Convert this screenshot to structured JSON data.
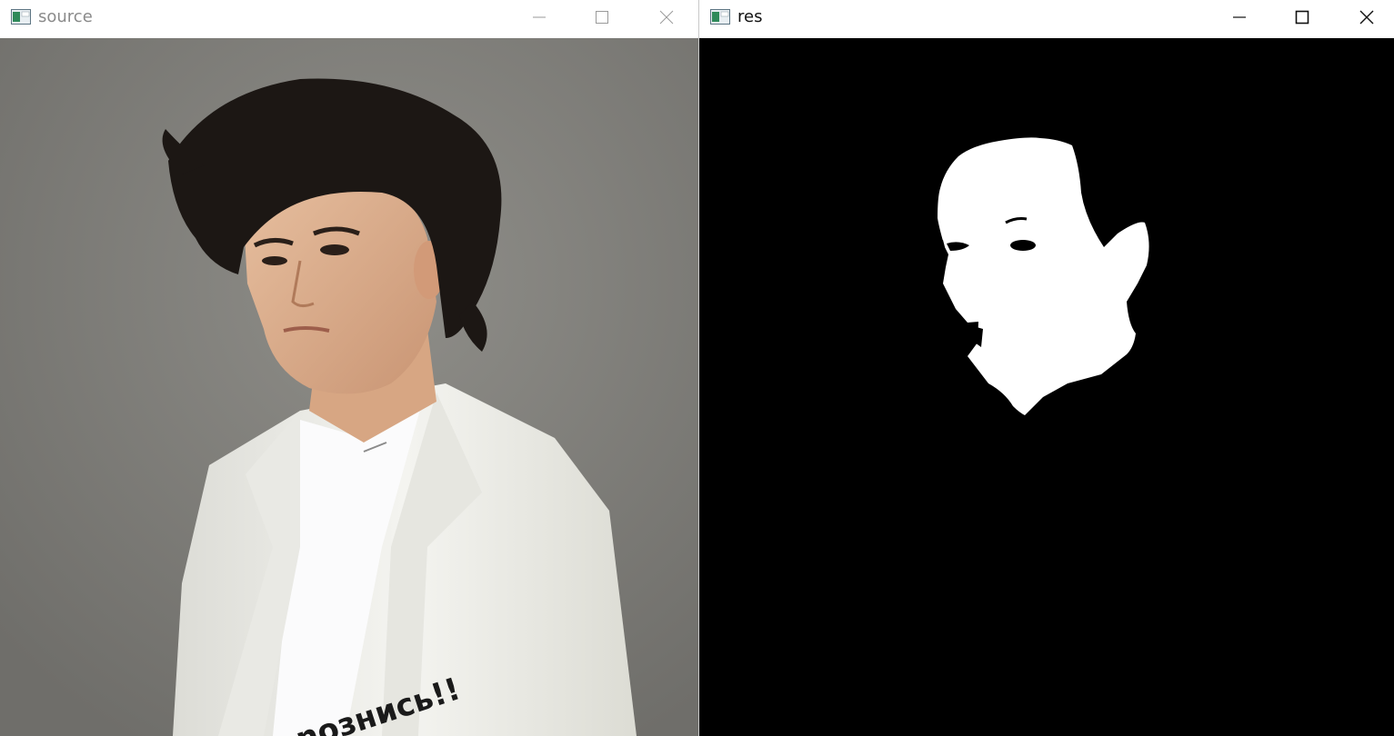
{
  "windows": {
    "source": {
      "title": "source",
      "controls": [
        "minimize-icon",
        "maximize-icon",
        "close-icon"
      ],
      "image_text": "noзнись!!"
    },
    "res": {
      "title": "res",
      "controls": [
        "minimize-icon",
        "maximize-icon",
        "close-icon"
      ]
    }
  },
  "colors": {
    "titlebar": "#ffffff",
    "inactive_title": "#8a8a8a",
    "active_title": "#111111",
    "photo_background": "#878682",
    "mask_background": "#000000",
    "mask_foreground": "#ffffff"
  }
}
